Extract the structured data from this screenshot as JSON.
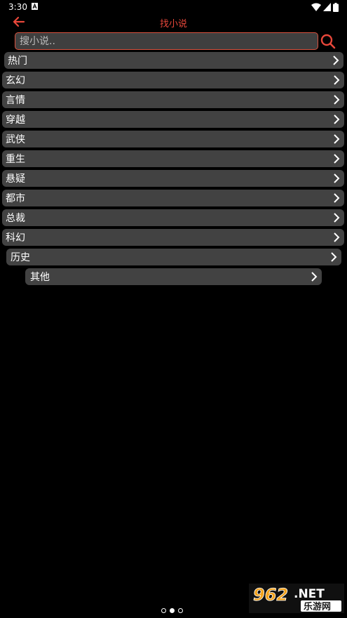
{
  "status_bar": {
    "time": "3:30"
  },
  "header": {
    "title": "找小说"
  },
  "search": {
    "placeholder": "搜小说.."
  },
  "categories": [
    {
      "label": "热门"
    },
    {
      "label": "玄幻"
    },
    {
      "label": "言情"
    },
    {
      "label": "穿越"
    },
    {
      "label": "武侠"
    },
    {
      "label": "重生"
    },
    {
      "label": "悬疑"
    },
    {
      "label": "都市"
    },
    {
      "label": "总裁"
    },
    {
      "label": "科幻"
    },
    {
      "label": "历史"
    },
    {
      "label": "其他"
    }
  ],
  "pager": {
    "active_index": 1,
    "count": 3
  },
  "colors": {
    "accent": "#e8473a",
    "background": "#000000",
    "item_background": "#424242"
  },
  "watermark": {
    "text": "962.NET 乐游网"
  }
}
